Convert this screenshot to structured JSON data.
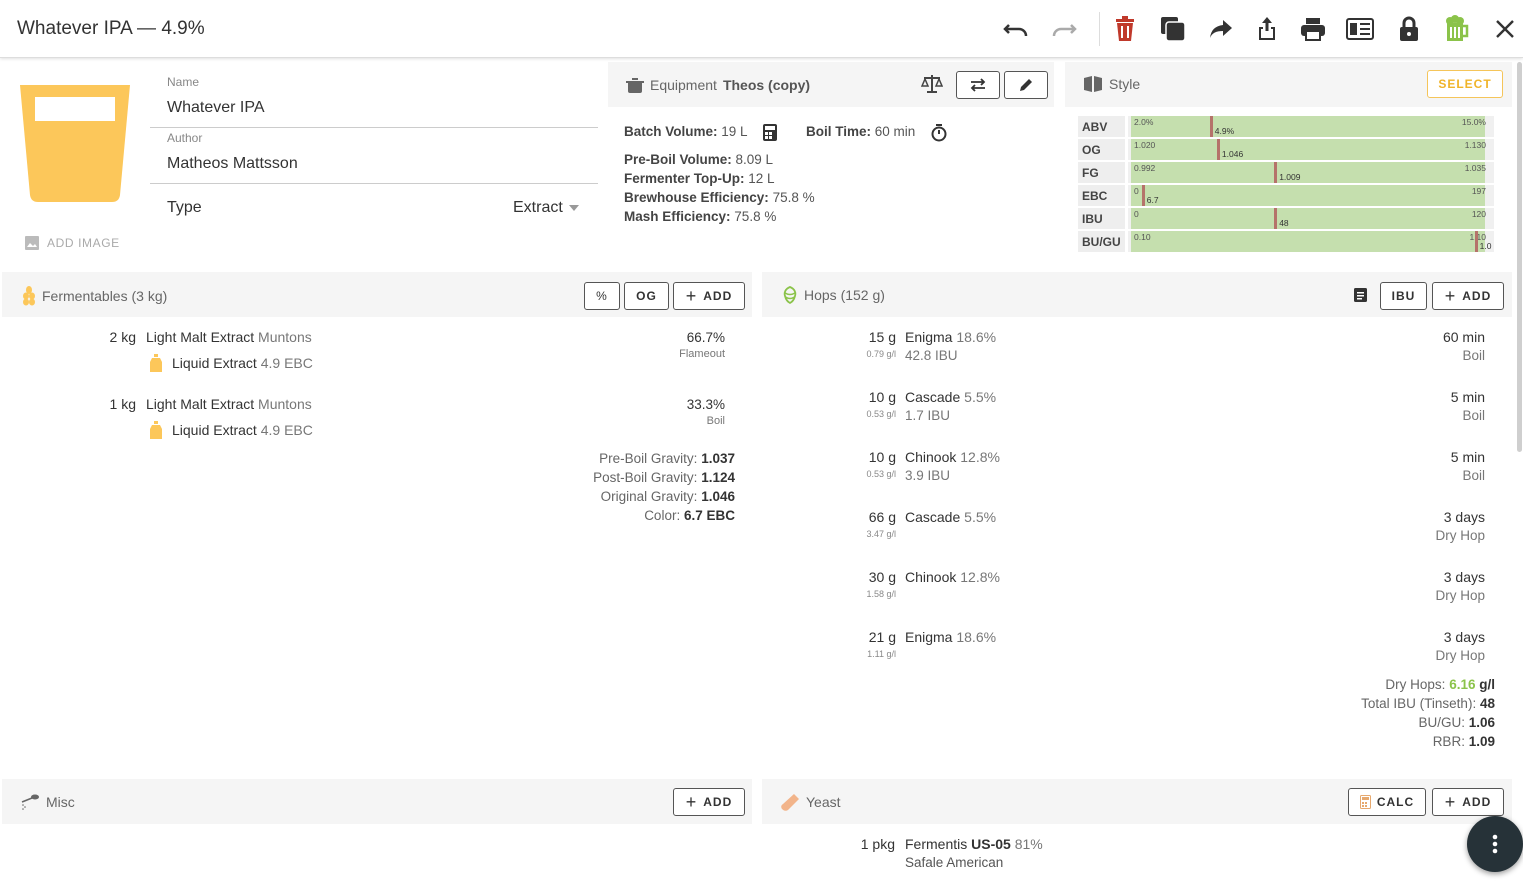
{
  "header": {
    "recipe_name": "Whatever IPA",
    "separator": " — ",
    "abv": "4.9%"
  },
  "recipe": {
    "name_label": "Name",
    "name_value": "Whatever IPA",
    "author_label": "Author",
    "author_value": "Matheos Mattsson",
    "type_label": "Type",
    "type_value": "Extract",
    "add_image_label": "ADD IMAGE",
    "glass_color": "#fcc75a"
  },
  "equipment": {
    "label": "Equipment",
    "name": "Theos (copy)",
    "batch_volume_label": "Batch Volume:",
    "batch_volume_value": "19 L",
    "boil_time_label": "Boil Time:",
    "boil_time_value": "60 min",
    "pre_boil_label": "Pre-Boil Volume:",
    "pre_boil_value": "8.09 L",
    "topup_label": "Fermenter Top-Up:",
    "topup_value": "12 L",
    "brewhouse_label": "Brewhouse Efficiency:",
    "brewhouse_value": "75.8 %",
    "mash_label": "Mash Efficiency:",
    "mash_value": "75.8 %"
  },
  "style": {
    "label": "Style",
    "select_label": "SELECT",
    "rows": [
      {
        "name": "ABV",
        "min": "2.0%",
        "max": "15.0%",
        "value": "4.9%",
        "range_fraction": [
          0.0,
          1.0
        ],
        "value_fraction": 0.22
      },
      {
        "name": "OG",
        "min": "1.020",
        "max": "1.130",
        "value": "1.046",
        "range_fraction": [
          0.0,
          1.0
        ],
        "value_fraction": 0.24
      },
      {
        "name": "FG",
        "min": "0.992",
        "max": "1.035",
        "value": "1.009",
        "range_fraction": [
          0.0,
          1.0
        ],
        "value_fraction": 0.4
      },
      {
        "name": "EBC",
        "min": "0",
        "max": "197",
        "value": "6.7",
        "range_fraction": [
          0.0,
          1.0
        ],
        "value_fraction": 0.03
      },
      {
        "name": "IBU",
        "min": "0",
        "max": "120",
        "value": "48",
        "range_fraction": [
          0.0,
          1.0
        ],
        "value_fraction": 0.4
      },
      {
        "name": "BU/GU",
        "min": "0.10",
        "max": "1.10",
        "value": "1.0",
        "range_fraction": [
          0.0,
          1.0
        ],
        "value_fraction": 0.96
      }
    ]
  },
  "fermentables": {
    "title": "Fermentables (3 kg)",
    "btn_percent": "%",
    "btn_og": "OG",
    "btn_add": "ADD",
    "items": [
      {
        "amount": "2 kg",
        "name": "Light Malt Extract",
        "brand": "Muntons",
        "type": "Liquid Extract",
        "ebc": "4.9 EBC",
        "percent": "66.7%",
        "use": "Flameout"
      },
      {
        "amount": "1 kg",
        "name": "Light Malt Extract",
        "brand": "Muntons",
        "type": "Liquid Extract",
        "ebc": "4.9 EBC",
        "percent": "33.3%",
        "use": "Boil"
      }
    ],
    "summary": {
      "pre_boil_label": "Pre-Boil Gravity:",
      "pre_boil_value": "1.037",
      "post_boil_label": "Post-Boil Gravity:",
      "post_boil_value": "1.124",
      "og_label": "Original Gravity:",
      "og_value": "1.046",
      "color_label": "Color:",
      "color_value": "6.7 EBC"
    }
  },
  "hops": {
    "title": "Hops (152 g)",
    "btn_ibu": "IBU",
    "btn_add": "ADD",
    "items": [
      {
        "amount": "15 g",
        "gl": "0.79 g/l",
        "name": "Enigma",
        "alpha": "18.6%",
        "ibu": "42.8 IBU",
        "time": "60 min",
        "use": "Boil"
      },
      {
        "amount": "10 g",
        "gl": "0.53 g/l",
        "name": "Cascade",
        "alpha": "5.5%",
        "ibu": "1.7 IBU",
        "time": "5 min",
        "use": "Boil"
      },
      {
        "amount": "10 g",
        "gl": "0.53 g/l",
        "name": "Chinook",
        "alpha": "12.8%",
        "ibu": "3.9 IBU",
        "time": "5 min",
        "use": "Boil"
      },
      {
        "amount": "66 g",
        "gl": "3.47 g/l",
        "name": "Cascade",
        "alpha": "5.5%",
        "ibu": "",
        "time": "3 days",
        "use": "Dry Hop"
      },
      {
        "amount": "30 g",
        "gl": "1.58 g/l",
        "name": "Chinook",
        "alpha": "12.8%",
        "ibu": "",
        "time": "3 days",
        "use": "Dry Hop"
      },
      {
        "amount": "21 g",
        "gl": "1.11 g/l",
        "name": "Enigma",
        "alpha": "18.6%",
        "ibu": "",
        "time": "3 days",
        "use": "Dry Hop"
      }
    ],
    "summary": {
      "dry_hops_label": "Dry Hops:",
      "dry_hops_value": "6.16",
      "dry_hops_unit": "g/l",
      "total_ibu_label": "Total IBU (Tinseth):",
      "total_ibu_value": "48",
      "bugu_label": "BU/GU:",
      "bugu_value": "1.06",
      "rbr_label": "RBR:",
      "rbr_value": "1.09"
    }
  },
  "misc": {
    "title": "Misc",
    "btn_add": "ADD"
  },
  "yeast": {
    "title": "Yeast",
    "btn_calc": "CALC",
    "btn_add": "ADD",
    "amount": "1 pkg",
    "lab": "Fermentis",
    "product": "US-05",
    "attenuation": "81%",
    "name": "Safale American"
  },
  "colors": {
    "accent": "#f0b429",
    "delete_red": "#c0392b",
    "beer_green": "#8bc34a",
    "range_green": "#c5dfae",
    "marker": "#b5736a"
  }
}
